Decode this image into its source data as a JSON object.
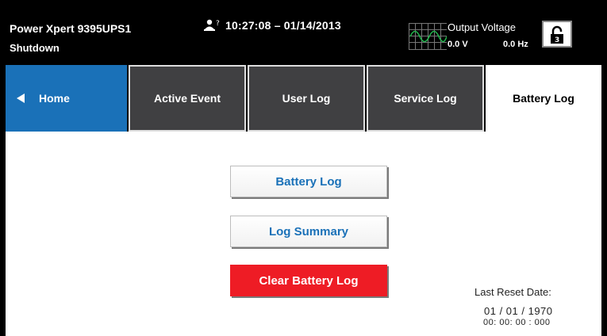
{
  "header": {
    "device_name": "Power Xpert 9395UPS1",
    "status": "Shutdown",
    "user_level": "?",
    "datetime": "10:27:08 – 01/14/2013",
    "output_voltage_label": "Output Voltage",
    "output_volts": "0.0 V",
    "output_hz": "0.0 Hz",
    "lock_level": "3"
  },
  "tabs": [
    {
      "label": "Home"
    },
    {
      "label": "Active Event"
    },
    {
      "label": "User Log"
    },
    {
      "label": "Service Log"
    },
    {
      "label": "Battery Log"
    }
  ],
  "main": {
    "battery_log_button": "Battery Log",
    "log_summary_button": "Log Summary",
    "clear_battery_log_button": "Clear Battery Log",
    "last_reset_label": "Last Reset Date:",
    "last_reset_date": "01 / 01 / 1970",
    "last_reset_time": "00: 00: 00 : 000"
  },
  "colors": {
    "home_tab": "#1a71b8",
    "inactive_tab": "#404042",
    "clear_button": "#ee1c25",
    "button_text": "#1a71b8"
  }
}
